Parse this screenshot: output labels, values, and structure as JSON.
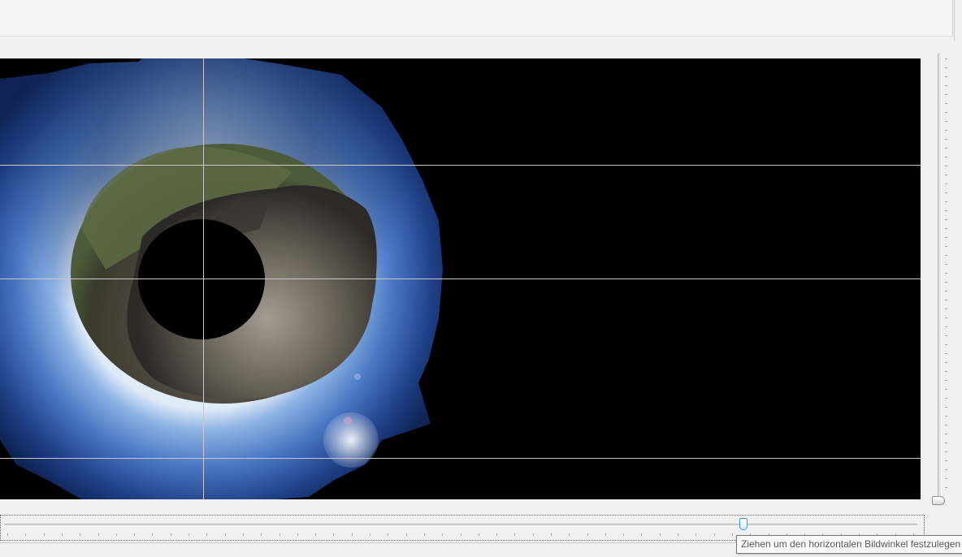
{
  "window": {
    "panel_background": "#f0f0f0",
    "canvas_background": "#000000"
  },
  "preview": {
    "content": "little-planet-panorama",
    "guide_color": "#c8c8c8"
  },
  "fov_slider_horizontal": {
    "tooltip": "Ziehen um den horizontalen Bildwinkel festzulegen",
    "thumb_color": "#3c9bd4"
  },
  "fov_slider_vertical": {
    "thumb_color": "#8e8e8e"
  }
}
